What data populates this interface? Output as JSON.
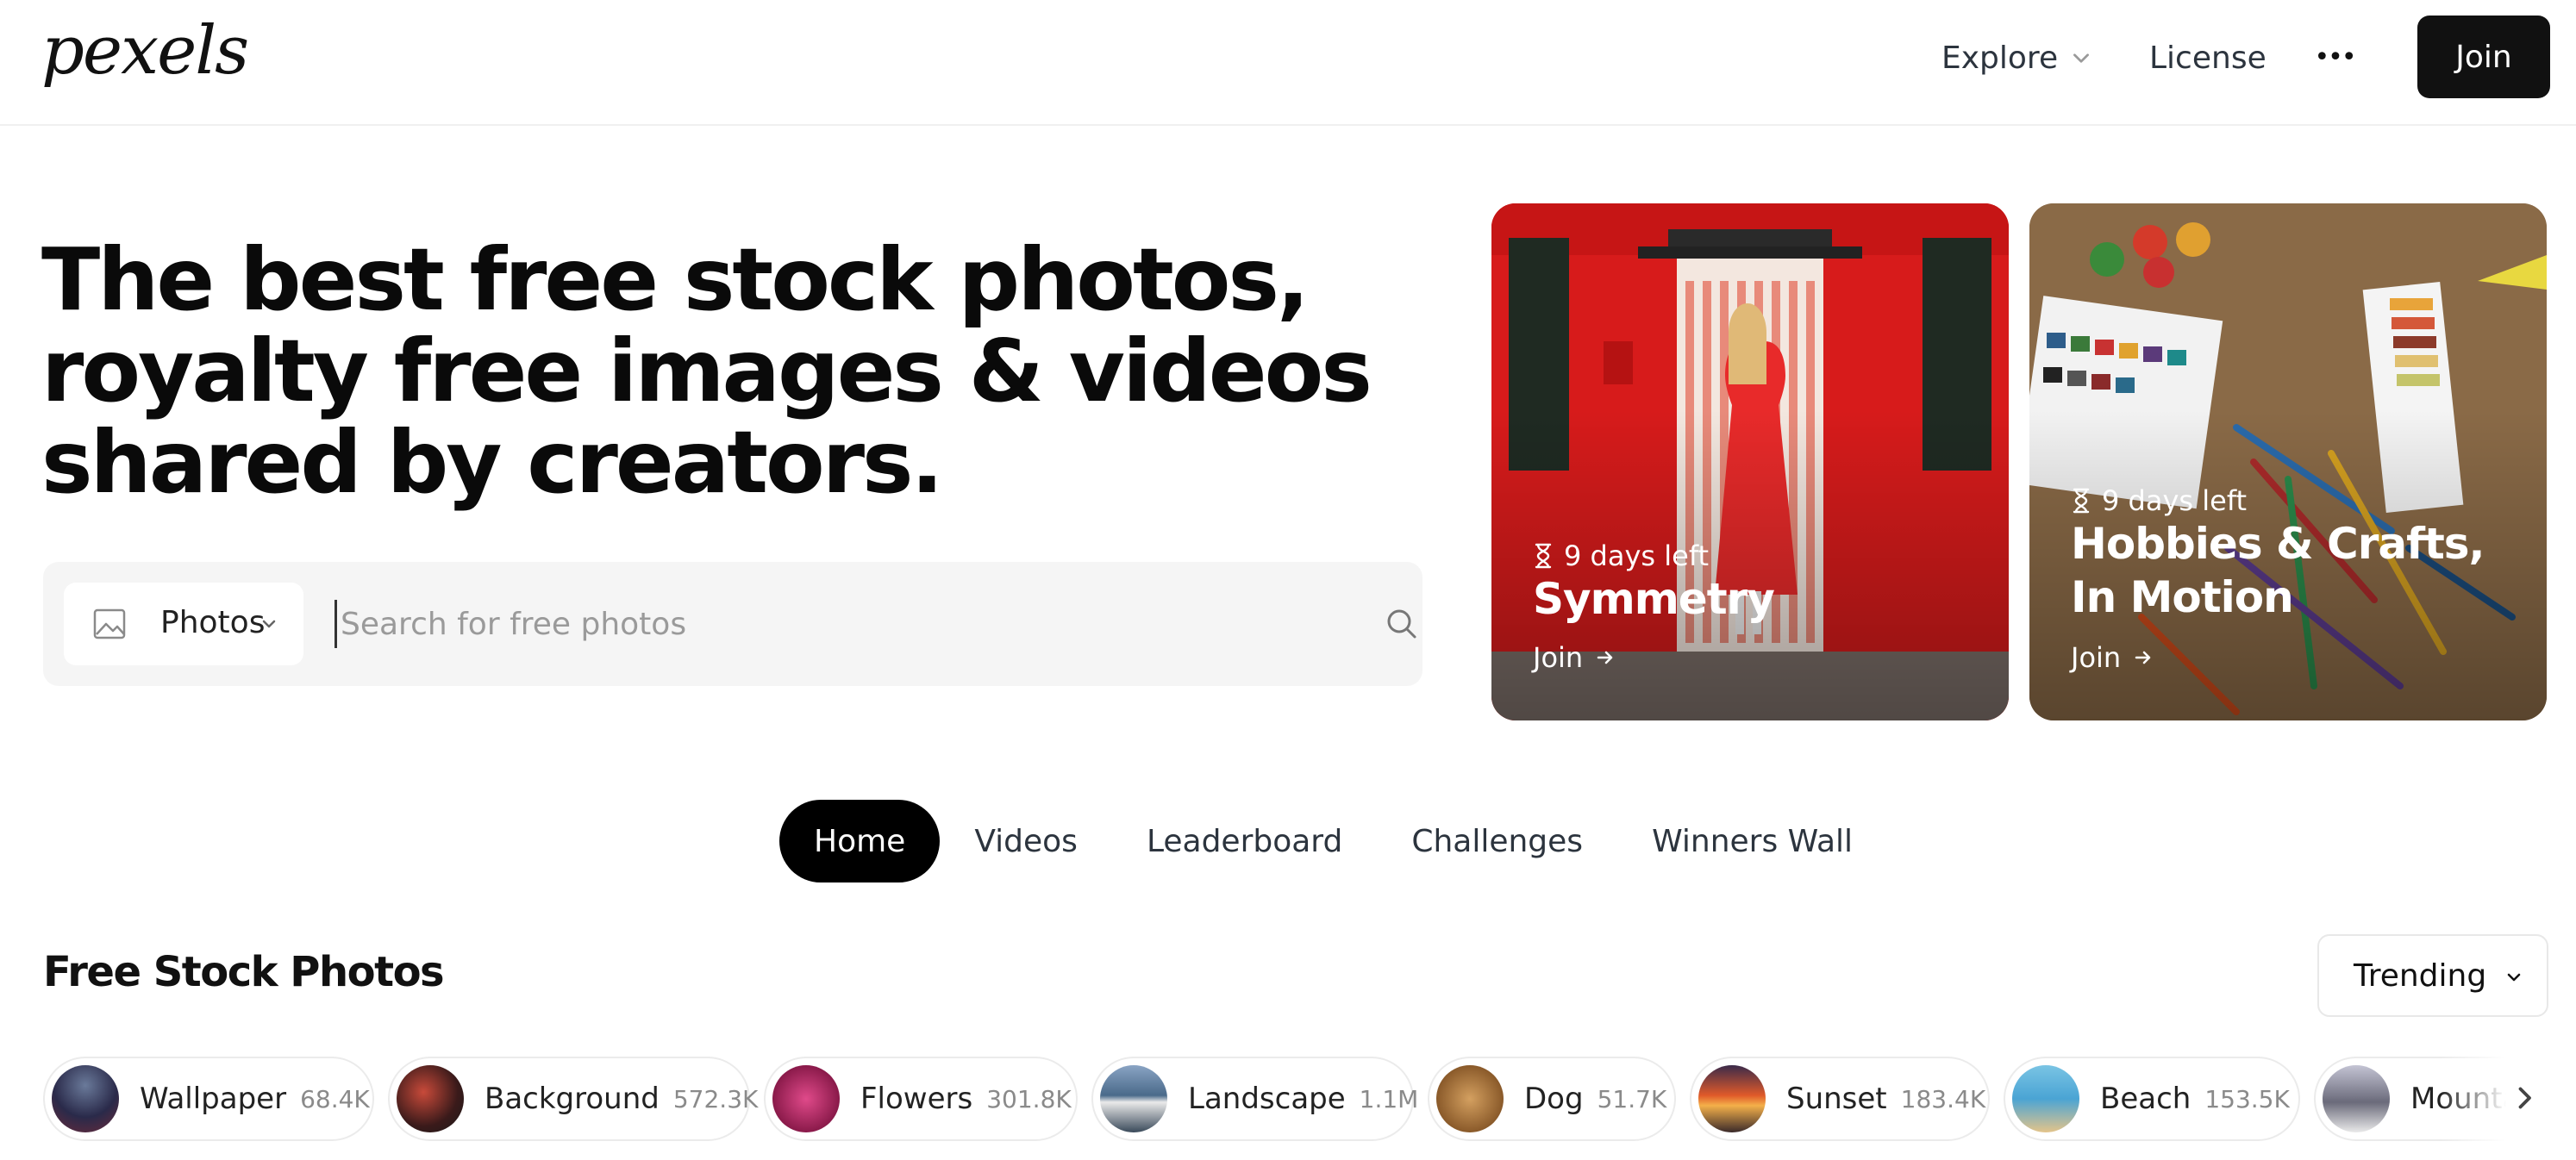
{
  "header": {
    "logo": "pexels",
    "nav": {
      "explore": "Explore",
      "license": "License",
      "more": "•••"
    },
    "join": "Join"
  },
  "hero": {
    "title": "The best free stock photos, royalty free images & videos shared by creators.",
    "search": {
      "type": "Photos",
      "placeholder": "Search for free photos"
    }
  },
  "challenges": [
    {
      "days_left": "9 days left",
      "title": "Symmetry",
      "join": "Join"
    },
    {
      "days_left": "9 days left",
      "title": "Hobbies & Crafts, In Motion",
      "join": "Join"
    }
  ],
  "tabs": [
    "Home",
    "Videos",
    "Leaderboard",
    "Challenges",
    "Winners Wall"
  ],
  "section": {
    "title": "Free Stock Photos",
    "sort": "Trending"
  },
  "chips": [
    {
      "label": "Wallpaper",
      "count": "68.4K"
    },
    {
      "label": "Background",
      "count": "572.3K"
    },
    {
      "label": "Flowers",
      "count": "301.8K"
    },
    {
      "label": "Landscape",
      "count": "1.1M"
    },
    {
      "label": "Dog",
      "count": "51.7K"
    },
    {
      "label": "Sunset",
      "count": "183.4K"
    },
    {
      "label": "Beach",
      "count": "153.5K"
    },
    {
      "label": "Mountain",
      "count": ""
    }
  ],
  "colors": {
    "primary": "#000000",
    "card1": "#d91a1a",
    "card2": "#8a6a47"
  }
}
